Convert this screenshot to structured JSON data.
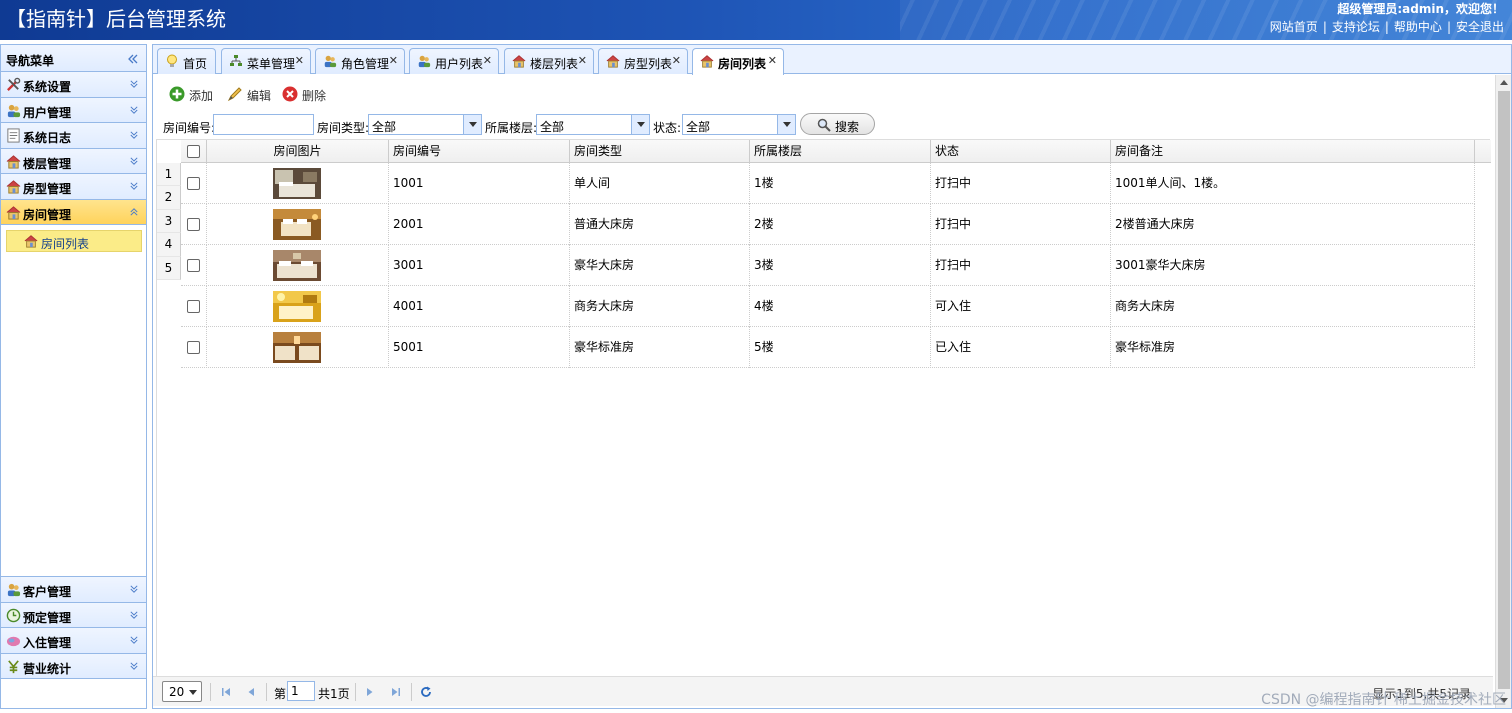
{
  "header": {
    "title": "【指南针】后台管理系统",
    "welcome": "超级管理员:admin，欢迎您！",
    "links": [
      "网站首页",
      "支持论坛",
      "帮助中心",
      "安全退出"
    ],
    "separator": "|"
  },
  "sidebar": {
    "title": "导航菜单",
    "top_items": [
      {
        "label": "系统设置",
        "icon": "tools-icon"
      },
      {
        "label": "用户管理",
        "icon": "users-icon"
      },
      {
        "label": "系统日志",
        "icon": "log-icon"
      },
      {
        "label": "楼层管理",
        "icon": "house-icon"
      },
      {
        "label": "房型管理",
        "icon": "house-icon"
      },
      {
        "label": "房间管理",
        "icon": "house-icon",
        "active": true
      }
    ],
    "sub_item": {
      "label": "房间列表",
      "icon": "house-icon"
    },
    "bottom_items": [
      {
        "label": "客户管理",
        "icon": "users-icon"
      },
      {
        "label": "预定管理",
        "icon": "clock-icon"
      },
      {
        "label": "入住管理",
        "icon": "checkin-icon"
      },
      {
        "label": "营业统计",
        "icon": "yen-icon"
      }
    ]
  },
  "tabs": [
    {
      "label": "首页",
      "icon": "bulb-icon",
      "closable": false
    },
    {
      "label": "菜单管理",
      "icon": "tree-icon",
      "closable": true
    },
    {
      "label": "角色管理",
      "icon": "users-icon",
      "closable": true
    },
    {
      "label": "用户列表",
      "icon": "users-icon",
      "closable": true
    },
    {
      "label": "楼层列表",
      "icon": "house-icon",
      "closable": true
    },
    {
      "label": "房型列表",
      "icon": "house-icon",
      "closable": true
    },
    {
      "label": "房间列表",
      "icon": "house-icon",
      "closable": true,
      "active": true
    }
  ],
  "toolbar": {
    "add": "添加",
    "edit": "编辑",
    "delete": "删除"
  },
  "filters": {
    "room_no_label": "房间编号:",
    "room_no_value": "",
    "room_type_label": "房间类型:",
    "room_type_value": "全部",
    "floor_label": "所属楼层:",
    "floor_value": "全部",
    "status_label": "状态:",
    "status_value": "全部",
    "search": "搜索"
  },
  "grid": {
    "columns": [
      "房间图片",
      "房间编号",
      "房间类型",
      "所属楼层",
      "状态",
      "房间备注"
    ],
    "row_numbers": [
      "1",
      "2",
      "3",
      "4",
      "5"
    ],
    "rows": [
      {
        "no": "1001",
        "type": "单人间",
        "floor": "1楼",
        "status": "打扫中",
        "remark": "1001单人间、1楼。"
      },
      {
        "no": "2001",
        "type": "普通大床房",
        "floor": "2楼",
        "status": "打扫中",
        "remark": "2楼普通大床房"
      },
      {
        "no": "3001",
        "type": "豪华大床房",
        "floor": "3楼",
        "status": "打扫中",
        "remark": "3001豪华大床房"
      },
      {
        "no": "4001",
        "type": "商务大床房",
        "floor": "4楼",
        "status": "可入住",
        "remark": "商务大床房"
      },
      {
        "no": "5001",
        "type": "豪华标准房",
        "floor": "5楼",
        "status": "已入住",
        "remark": "豪华标准房"
      }
    ]
  },
  "pager": {
    "page_size": "20",
    "page_prefix": "第",
    "page_value": "1",
    "page_suffix": "共1页",
    "info": "显示1到5,共5记录"
  },
  "watermark": "CSDN @编程指南针  稀土掘金技术社区",
  "colors": {
    "header_blue": "#1e54b5",
    "panel_border": "#95b8e7",
    "active_yellow": "#ffd35c"
  }
}
